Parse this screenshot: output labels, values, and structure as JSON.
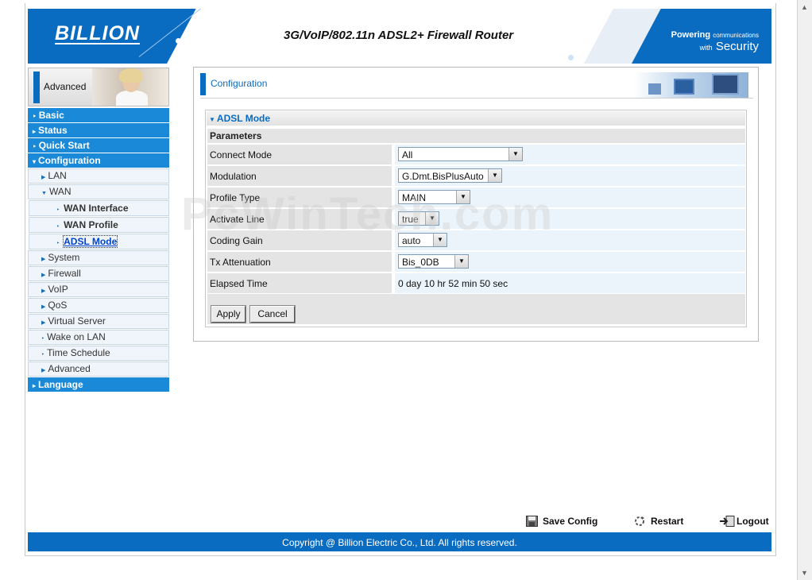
{
  "header": {
    "brand": "BILLION",
    "router_title": "3G/VoIP/802.11n ADSL2+ Firewall Router",
    "slogan_powering": "Powering",
    "slogan_communications": "communications",
    "slogan_with": "with",
    "slogan_security": "Security"
  },
  "sidebar": {
    "mode_label": "Advanced",
    "items": [
      {
        "label": "Basic"
      },
      {
        "label": "Status"
      },
      {
        "label": "Quick Start"
      },
      {
        "label": "Configuration"
      },
      {
        "label": "LAN"
      },
      {
        "label": "WAN"
      },
      {
        "label": "WAN Interface"
      },
      {
        "label": "WAN Profile"
      },
      {
        "label": "ADSL Mode"
      },
      {
        "label": "System"
      },
      {
        "label": "Firewall"
      },
      {
        "label": "VoIP"
      },
      {
        "label": "QoS"
      },
      {
        "label": "Virtual Server"
      },
      {
        "label": "Wake on LAN"
      },
      {
        "label": "Time Schedule"
      },
      {
        "label": "Advanced"
      },
      {
        "label": "Language"
      }
    ]
  },
  "main": {
    "section_title": "Configuration",
    "panel_title": "ADSL Mode",
    "params_header": "Parameters",
    "rows": [
      {
        "label": "Connect Mode",
        "value": "All"
      },
      {
        "label": "Modulation",
        "value": "G.Dmt.BisPlusAuto"
      },
      {
        "label": "Profile Type",
        "value": "MAIN"
      },
      {
        "label": "Activate Line",
        "value": "true"
      },
      {
        "label": "Coding Gain",
        "value": "auto"
      },
      {
        "label": "Tx Attenuation",
        "value": "Bis_0DB"
      },
      {
        "label": "Elapsed Time",
        "value": "0 day 10 hr 52 min 50 sec"
      }
    ],
    "apply_label": "Apply",
    "cancel_label": "Cancel"
  },
  "watermark": "PcWinTech.com",
  "toolbar": {
    "save_config": "Save Config",
    "restart": "Restart",
    "logout": "Logout"
  },
  "footer": {
    "copyright": "Copyright @ Billion Electric Co., Ltd. All rights reserved."
  },
  "colors": {
    "brand_blue": "#0a6cc0",
    "nav_blue": "#1a8ad8",
    "value_bg": "#ecf4fb"
  }
}
